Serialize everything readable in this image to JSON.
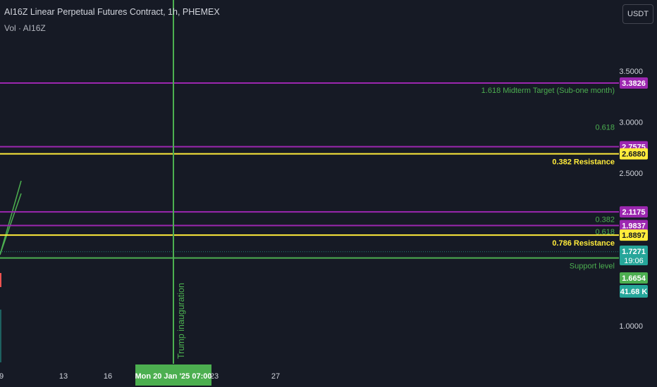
{
  "header": {
    "title": "AI16Z Linear Perpetual Futures Contract, 1h, PHEMEX",
    "volume_label": "Vol · AI16Z",
    "currency_button": "USDT"
  },
  "colors": {
    "background": "#161a25",
    "purple": "#9c27b0",
    "yellow": "#ffeb3b",
    "green": "#4caf50",
    "teal": "#26a69a",
    "axis_text": "#d1d4dc"
  },
  "chart_data": {
    "type": "line",
    "price_axis_ticks": [
      "3.5000",
      "3.0000",
      "2.5000",
      "1.0000"
    ],
    "time_axis_ticks": [
      "9",
      "13",
      "16",
      "23",
      "27"
    ],
    "crosshair_time_label": "Mon 20 Jan '25   07:00",
    "vertical_event": {
      "label": "Trump inauguration",
      "time": "Mon 20 Jan '25 07:00"
    },
    "horizontal_levels": [
      {
        "price": 3.3826,
        "label": "3.3826",
        "color": "purple",
        "annotation": "1.618 Midterm Target (Sub-one month)"
      },
      {
        "price": 2.7575,
        "label": "2.7575",
        "color": "purple",
        "annotation": "0.618"
      },
      {
        "price": 2.688,
        "label": "2.6880",
        "color": "yellow",
        "annotation": "0.382 Resistance"
      },
      {
        "price": 2.1175,
        "label": "2.1175",
        "color": "purple",
        "annotation": ""
      },
      {
        "price": 1.9837,
        "label": "1.9837",
        "color": "purple",
        "annotation": "0.382"
      },
      {
        "price": 1.8897,
        "label": "1.8897",
        "color": "yellow",
        "annotation": "0.618"
      },
      {
        "price": 1.8897,
        "label": "",
        "color": "yellow",
        "annotation": "0.786 Resistance"
      },
      {
        "price": 1.6654,
        "label": "1.6654",
        "color": "green",
        "annotation": "Support level"
      }
    ],
    "last_price": {
      "price": 1.7271,
      "label": "1.7271",
      "countdown": "19:06"
    },
    "volume_label": "41.68 K"
  }
}
